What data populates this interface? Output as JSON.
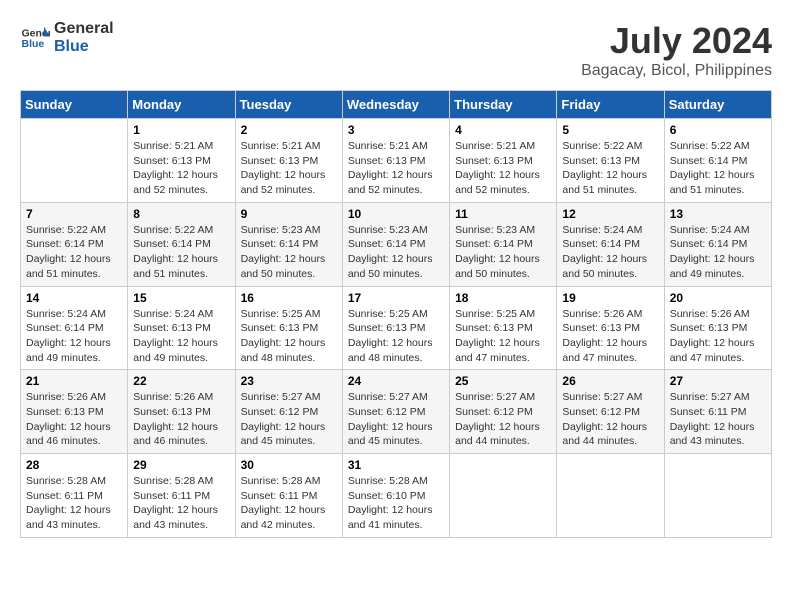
{
  "logo": {
    "line1": "General",
    "line2": "Blue"
  },
  "title": "July 2024",
  "subtitle": "Bagacay, Bicol, Philippines",
  "days_of_week": [
    "Sunday",
    "Monday",
    "Tuesday",
    "Wednesday",
    "Thursday",
    "Friday",
    "Saturday"
  ],
  "weeks": [
    [
      {
        "day": "",
        "info": ""
      },
      {
        "day": "1",
        "info": "Sunrise: 5:21 AM\nSunset: 6:13 PM\nDaylight: 12 hours\nand 52 minutes."
      },
      {
        "day": "2",
        "info": "Sunrise: 5:21 AM\nSunset: 6:13 PM\nDaylight: 12 hours\nand 52 minutes."
      },
      {
        "day": "3",
        "info": "Sunrise: 5:21 AM\nSunset: 6:13 PM\nDaylight: 12 hours\nand 52 minutes."
      },
      {
        "day": "4",
        "info": "Sunrise: 5:21 AM\nSunset: 6:13 PM\nDaylight: 12 hours\nand 52 minutes."
      },
      {
        "day": "5",
        "info": "Sunrise: 5:22 AM\nSunset: 6:13 PM\nDaylight: 12 hours\nand 51 minutes."
      },
      {
        "day": "6",
        "info": "Sunrise: 5:22 AM\nSunset: 6:14 PM\nDaylight: 12 hours\nand 51 minutes."
      }
    ],
    [
      {
        "day": "7",
        "info": "Sunrise: 5:22 AM\nSunset: 6:14 PM\nDaylight: 12 hours\nand 51 minutes."
      },
      {
        "day": "8",
        "info": "Sunrise: 5:22 AM\nSunset: 6:14 PM\nDaylight: 12 hours\nand 51 minutes."
      },
      {
        "day": "9",
        "info": "Sunrise: 5:23 AM\nSunset: 6:14 PM\nDaylight: 12 hours\nand 50 minutes."
      },
      {
        "day": "10",
        "info": "Sunrise: 5:23 AM\nSunset: 6:14 PM\nDaylight: 12 hours\nand 50 minutes."
      },
      {
        "day": "11",
        "info": "Sunrise: 5:23 AM\nSunset: 6:14 PM\nDaylight: 12 hours\nand 50 minutes."
      },
      {
        "day": "12",
        "info": "Sunrise: 5:24 AM\nSunset: 6:14 PM\nDaylight: 12 hours\nand 50 minutes."
      },
      {
        "day": "13",
        "info": "Sunrise: 5:24 AM\nSunset: 6:14 PM\nDaylight: 12 hours\nand 49 minutes."
      }
    ],
    [
      {
        "day": "14",
        "info": "Sunrise: 5:24 AM\nSunset: 6:14 PM\nDaylight: 12 hours\nand 49 minutes."
      },
      {
        "day": "15",
        "info": "Sunrise: 5:24 AM\nSunset: 6:13 PM\nDaylight: 12 hours\nand 49 minutes."
      },
      {
        "day": "16",
        "info": "Sunrise: 5:25 AM\nSunset: 6:13 PM\nDaylight: 12 hours\nand 48 minutes."
      },
      {
        "day": "17",
        "info": "Sunrise: 5:25 AM\nSunset: 6:13 PM\nDaylight: 12 hours\nand 48 minutes."
      },
      {
        "day": "18",
        "info": "Sunrise: 5:25 AM\nSunset: 6:13 PM\nDaylight: 12 hours\nand 47 minutes."
      },
      {
        "day": "19",
        "info": "Sunrise: 5:26 AM\nSunset: 6:13 PM\nDaylight: 12 hours\nand 47 minutes."
      },
      {
        "day": "20",
        "info": "Sunrise: 5:26 AM\nSunset: 6:13 PM\nDaylight: 12 hours\nand 47 minutes."
      }
    ],
    [
      {
        "day": "21",
        "info": "Sunrise: 5:26 AM\nSunset: 6:13 PM\nDaylight: 12 hours\nand 46 minutes."
      },
      {
        "day": "22",
        "info": "Sunrise: 5:26 AM\nSunset: 6:13 PM\nDaylight: 12 hours\nand 46 minutes."
      },
      {
        "day": "23",
        "info": "Sunrise: 5:27 AM\nSunset: 6:12 PM\nDaylight: 12 hours\nand 45 minutes."
      },
      {
        "day": "24",
        "info": "Sunrise: 5:27 AM\nSunset: 6:12 PM\nDaylight: 12 hours\nand 45 minutes."
      },
      {
        "day": "25",
        "info": "Sunrise: 5:27 AM\nSunset: 6:12 PM\nDaylight: 12 hours\nand 44 minutes."
      },
      {
        "day": "26",
        "info": "Sunrise: 5:27 AM\nSunset: 6:12 PM\nDaylight: 12 hours\nand 44 minutes."
      },
      {
        "day": "27",
        "info": "Sunrise: 5:27 AM\nSunset: 6:11 PM\nDaylight: 12 hours\nand 43 minutes."
      }
    ],
    [
      {
        "day": "28",
        "info": "Sunrise: 5:28 AM\nSunset: 6:11 PM\nDaylight: 12 hours\nand 43 minutes."
      },
      {
        "day": "29",
        "info": "Sunrise: 5:28 AM\nSunset: 6:11 PM\nDaylight: 12 hours\nand 43 minutes."
      },
      {
        "day": "30",
        "info": "Sunrise: 5:28 AM\nSunset: 6:11 PM\nDaylight: 12 hours\nand 42 minutes."
      },
      {
        "day": "31",
        "info": "Sunrise: 5:28 AM\nSunset: 6:10 PM\nDaylight: 12 hours\nand 41 minutes."
      },
      {
        "day": "",
        "info": ""
      },
      {
        "day": "",
        "info": ""
      },
      {
        "day": "",
        "info": ""
      }
    ]
  ]
}
